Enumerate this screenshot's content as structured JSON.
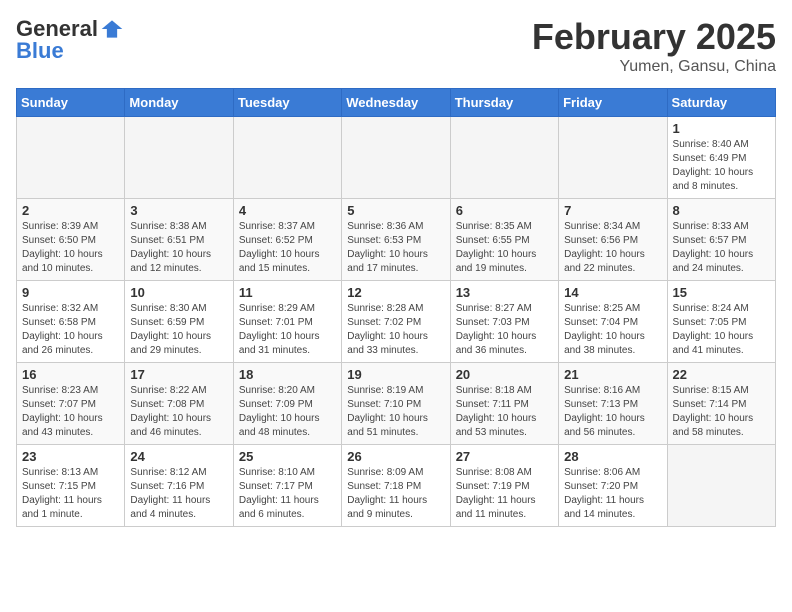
{
  "header": {
    "logo_general": "General",
    "logo_blue": "Blue",
    "month": "February 2025",
    "location": "Yumen, Gansu, China"
  },
  "days_of_week": [
    "Sunday",
    "Monday",
    "Tuesday",
    "Wednesday",
    "Thursday",
    "Friday",
    "Saturday"
  ],
  "weeks": [
    [
      {
        "day": "",
        "info": ""
      },
      {
        "day": "",
        "info": ""
      },
      {
        "day": "",
        "info": ""
      },
      {
        "day": "",
        "info": ""
      },
      {
        "day": "",
        "info": ""
      },
      {
        "day": "",
        "info": ""
      },
      {
        "day": "1",
        "info": "Sunrise: 8:40 AM\nSunset: 6:49 PM\nDaylight: 10 hours and 8 minutes."
      }
    ],
    [
      {
        "day": "2",
        "info": "Sunrise: 8:39 AM\nSunset: 6:50 PM\nDaylight: 10 hours and 10 minutes."
      },
      {
        "day": "3",
        "info": "Sunrise: 8:38 AM\nSunset: 6:51 PM\nDaylight: 10 hours and 12 minutes."
      },
      {
        "day": "4",
        "info": "Sunrise: 8:37 AM\nSunset: 6:52 PM\nDaylight: 10 hours and 15 minutes."
      },
      {
        "day": "5",
        "info": "Sunrise: 8:36 AM\nSunset: 6:53 PM\nDaylight: 10 hours and 17 minutes."
      },
      {
        "day": "6",
        "info": "Sunrise: 8:35 AM\nSunset: 6:55 PM\nDaylight: 10 hours and 19 minutes."
      },
      {
        "day": "7",
        "info": "Sunrise: 8:34 AM\nSunset: 6:56 PM\nDaylight: 10 hours and 22 minutes."
      },
      {
        "day": "8",
        "info": "Sunrise: 8:33 AM\nSunset: 6:57 PM\nDaylight: 10 hours and 24 minutes."
      }
    ],
    [
      {
        "day": "9",
        "info": "Sunrise: 8:32 AM\nSunset: 6:58 PM\nDaylight: 10 hours and 26 minutes."
      },
      {
        "day": "10",
        "info": "Sunrise: 8:30 AM\nSunset: 6:59 PM\nDaylight: 10 hours and 29 minutes."
      },
      {
        "day": "11",
        "info": "Sunrise: 8:29 AM\nSunset: 7:01 PM\nDaylight: 10 hours and 31 minutes."
      },
      {
        "day": "12",
        "info": "Sunrise: 8:28 AM\nSunset: 7:02 PM\nDaylight: 10 hours and 33 minutes."
      },
      {
        "day": "13",
        "info": "Sunrise: 8:27 AM\nSunset: 7:03 PM\nDaylight: 10 hours and 36 minutes."
      },
      {
        "day": "14",
        "info": "Sunrise: 8:25 AM\nSunset: 7:04 PM\nDaylight: 10 hours and 38 minutes."
      },
      {
        "day": "15",
        "info": "Sunrise: 8:24 AM\nSunset: 7:05 PM\nDaylight: 10 hours and 41 minutes."
      }
    ],
    [
      {
        "day": "16",
        "info": "Sunrise: 8:23 AM\nSunset: 7:07 PM\nDaylight: 10 hours and 43 minutes."
      },
      {
        "day": "17",
        "info": "Sunrise: 8:22 AM\nSunset: 7:08 PM\nDaylight: 10 hours and 46 minutes."
      },
      {
        "day": "18",
        "info": "Sunrise: 8:20 AM\nSunset: 7:09 PM\nDaylight: 10 hours and 48 minutes."
      },
      {
        "day": "19",
        "info": "Sunrise: 8:19 AM\nSunset: 7:10 PM\nDaylight: 10 hours and 51 minutes."
      },
      {
        "day": "20",
        "info": "Sunrise: 8:18 AM\nSunset: 7:11 PM\nDaylight: 10 hours and 53 minutes."
      },
      {
        "day": "21",
        "info": "Sunrise: 8:16 AM\nSunset: 7:13 PM\nDaylight: 10 hours and 56 minutes."
      },
      {
        "day": "22",
        "info": "Sunrise: 8:15 AM\nSunset: 7:14 PM\nDaylight: 10 hours and 58 minutes."
      }
    ],
    [
      {
        "day": "23",
        "info": "Sunrise: 8:13 AM\nSunset: 7:15 PM\nDaylight: 11 hours and 1 minute."
      },
      {
        "day": "24",
        "info": "Sunrise: 8:12 AM\nSunset: 7:16 PM\nDaylight: 11 hours and 4 minutes."
      },
      {
        "day": "25",
        "info": "Sunrise: 8:10 AM\nSunset: 7:17 PM\nDaylight: 11 hours and 6 minutes."
      },
      {
        "day": "26",
        "info": "Sunrise: 8:09 AM\nSunset: 7:18 PM\nDaylight: 11 hours and 9 minutes."
      },
      {
        "day": "27",
        "info": "Sunrise: 8:08 AM\nSunset: 7:19 PM\nDaylight: 11 hours and 11 minutes."
      },
      {
        "day": "28",
        "info": "Sunrise: 8:06 AM\nSunset: 7:20 PM\nDaylight: 11 hours and 14 minutes."
      },
      {
        "day": "",
        "info": ""
      }
    ]
  ]
}
